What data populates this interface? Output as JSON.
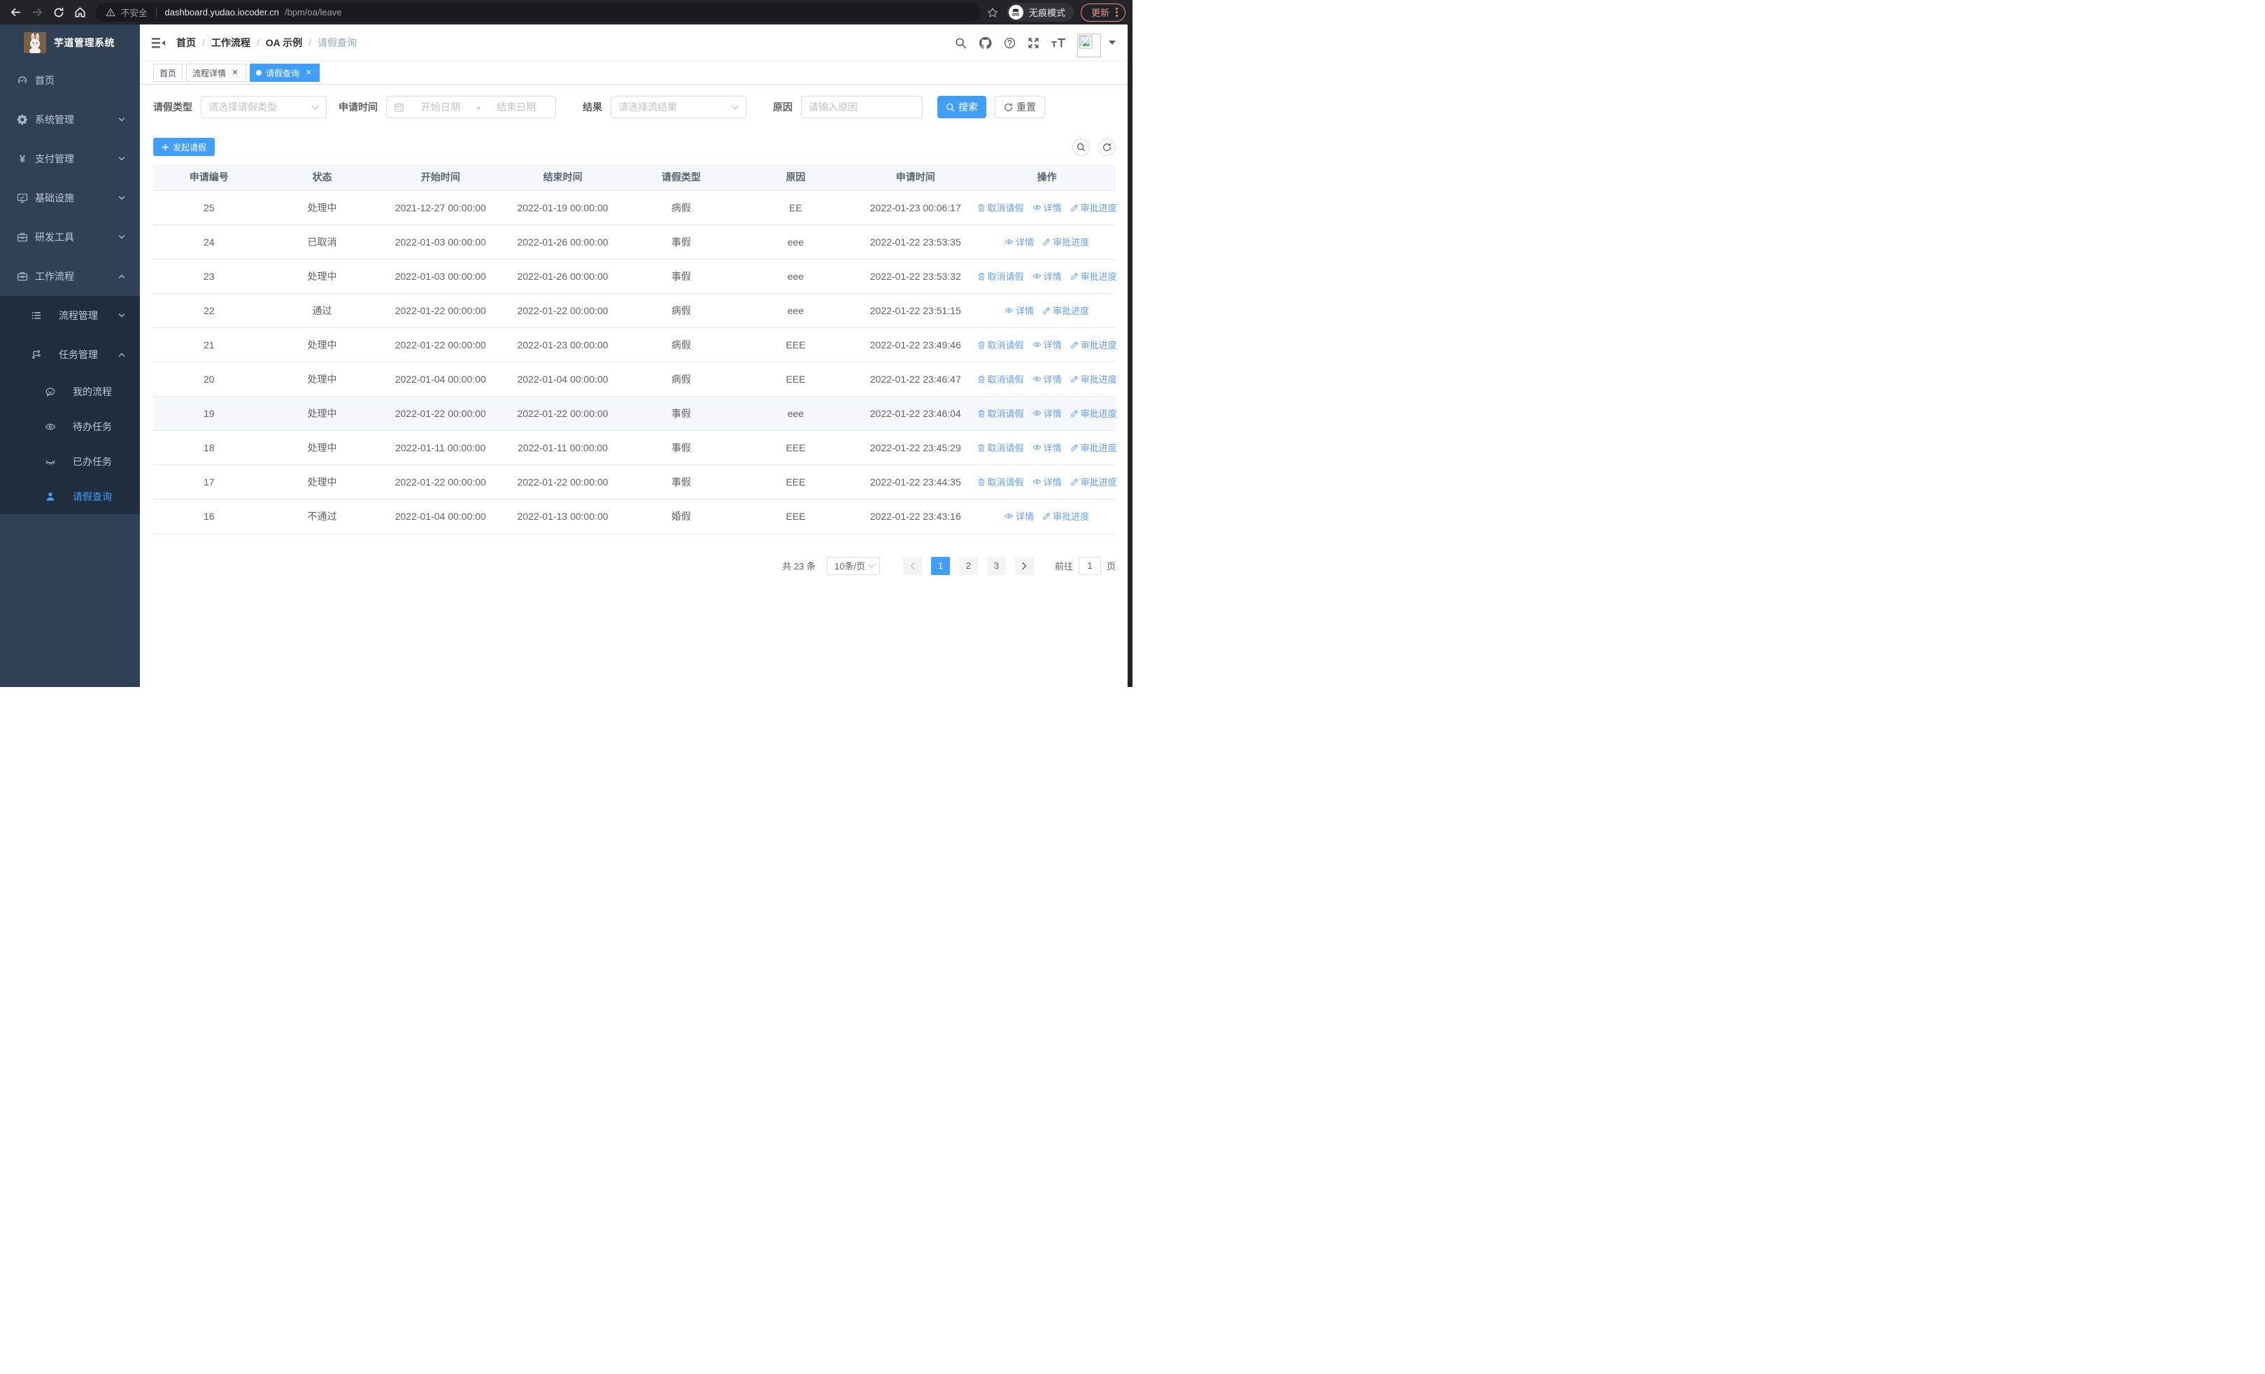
{
  "browser": {
    "security_warning": "不安全",
    "url_host": "dashboard.yudao.iocoder.cn",
    "url_path": "/bpm/oa/leave",
    "incognito_label": "无痕模式",
    "update_label": "更新"
  },
  "sidebar": {
    "app_title": "芋道管理系统",
    "menu": [
      {
        "label": "首页",
        "icon": "dashboard-icon",
        "level": 1
      },
      {
        "label": "系统管理",
        "icon": "gear-icon",
        "level": 1,
        "chevron": "down"
      },
      {
        "label": "支付管理",
        "icon": "yen-icon",
        "level": 1,
        "chevron": "down"
      },
      {
        "label": "基础设施",
        "icon": "monitor-icon",
        "level": 1,
        "chevron": "down"
      },
      {
        "label": "研发工具",
        "icon": "toolbox-icon",
        "level": 1,
        "chevron": "down"
      },
      {
        "label": "工作流程",
        "icon": "workflow-icon",
        "level": 1,
        "chevron": "up"
      },
      {
        "label": "流程管理",
        "icon": "process-list-icon",
        "level": 2,
        "chevron": "down",
        "dark": true
      },
      {
        "label": "任务管理",
        "icon": "task-node-icon",
        "level": 2,
        "chevron": "up",
        "dark": true
      },
      {
        "label": "我的流程",
        "icon": "my-process-icon",
        "level": 3,
        "dark": true
      },
      {
        "label": "待办任务",
        "icon": "eye-icon",
        "level": 3,
        "dark": true
      },
      {
        "label": "已办任务",
        "icon": "eye-closed-icon",
        "level": 3,
        "dark": true
      },
      {
        "label": "请假查询",
        "icon": "user-icon",
        "level": 3,
        "dark": true,
        "active": true
      }
    ]
  },
  "navbar": {
    "breadcrumb": [
      "首页",
      "工作流程",
      "OA 示例",
      "请假查询"
    ]
  },
  "tags": [
    {
      "label": "首页",
      "closable": false,
      "active": false
    },
    {
      "label": "流程详情",
      "closable": true,
      "active": false
    },
    {
      "label": "请假查询",
      "closable": true,
      "active": true
    }
  ],
  "filters": {
    "leave_type_label": "请假类型",
    "leave_type_placeholder": "请选择请假类型",
    "apply_time_label": "申请时间",
    "date_start_placeholder": "开始日期",
    "date_separator": "-",
    "date_end_placeholder": "结束日期",
    "result_label": "结果",
    "result_placeholder": "请选择流结果",
    "reason_label": "原因",
    "reason_placeholder": "请输入原因",
    "search_button": "搜索",
    "reset_button": "重置"
  },
  "toolbar": {
    "create_button": "发起请假"
  },
  "table": {
    "headers": [
      "申请编号",
      "状态",
      "开始时间",
      "结束时间",
      "请假类型",
      "原因",
      "申请时间",
      "操作"
    ],
    "action_labels": {
      "cancel": "取消请假",
      "detail": "详情",
      "progress": "审批进度"
    },
    "rows": [
      {
        "id": "25",
        "status": "处理中",
        "start": "2021-12-27 00:00:00",
        "end": "2022-01-19 00:00:00",
        "type": "病假",
        "reason": "EE",
        "apply_time": "2022-01-23 00:06:17",
        "actions": [
          "cancel",
          "detail",
          "progress"
        ],
        "highlight": false
      },
      {
        "id": "24",
        "status": "已取消",
        "start": "2022-01-03 00:00:00",
        "end": "2022-01-26 00:00:00",
        "type": "事假",
        "reason": "eee",
        "apply_time": "2022-01-22 23:53:35",
        "actions": [
          "detail",
          "progress"
        ],
        "highlight": false
      },
      {
        "id": "23",
        "status": "处理中",
        "start": "2022-01-03 00:00:00",
        "end": "2022-01-26 00:00:00",
        "type": "事假",
        "reason": "eee",
        "apply_time": "2022-01-22 23:53:32",
        "actions": [
          "cancel",
          "detail",
          "progress"
        ],
        "highlight": false
      },
      {
        "id": "22",
        "status": "通过",
        "start": "2022-01-22 00:00:00",
        "end": "2022-01-22 00:00:00",
        "type": "病假",
        "reason": "eee",
        "apply_time": "2022-01-22 23:51:15",
        "actions": [
          "detail",
          "progress"
        ],
        "highlight": false
      },
      {
        "id": "21",
        "status": "处理中",
        "start": "2022-01-22 00:00:00",
        "end": "2022-01-23 00:00:00",
        "type": "病假",
        "reason": "EEE",
        "apply_time": "2022-01-22 23:49:46",
        "actions": [
          "cancel",
          "detail",
          "progress"
        ],
        "highlight": false
      },
      {
        "id": "20",
        "status": "处理中",
        "start": "2022-01-04 00:00:00",
        "end": "2022-01-04 00:00:00",
        "type": "病假",
        "reason": "EEE",
        "apply_time": "2022-01-22 23:46:47",
        "actions": [
          "cancel",
          "detail",
          "progress"
        ],
        "highlight": false
      },
      {
        "id": "19",
        "status": "处理中",
        "start": "2022-01-22 00:00:00",
        "end": "2022-01-22 00:00:00",
        "type": "事假",
        "reason": "eee",
        "apply_time": "2022-01-22 23:46:04",
        "actions": [
          "cancel",
          "detail",
          "progress"
        ],
        "highlight": true
      },
      {
        "id": "18",
        "status": "处理中",
        "start": "2022-01-11 00:00:00",
        "end": "2022-01-11 00:00:00",
        "type": "事假",
        "reason": "EEE",
        "apply_time": "2022-01-22 23:45:29",
        "actions": [
          "cancel",
          "detail",
          "progress"
        ],
        "highlight": false
      },
      {
        "id": "17",
        "status": "处理中",
        "start": "2022-01-22 00:00:00",
        "end": "2022-01-22 00:00:00",
        "type": "事假",
        "reason": "EEE",
        "apply_time": "2022-01-22 23:44:35",
        "actions": [
          "cancel",
          "detail",
          "progress"
        ],
        "highlight": false
      },
      {
        "id": "16",
        "status": "不通过",
        "start": "2022-01-04 00:00:00",
        "end": "2022-01-13 00:00:00",
        "type": "婚假",
        "reason": "EEE",
        "apply_time": "2022-01-22 23:43:16",
        "actions": [
          "detail",
          "progress"
        ],
        "highlight": false
      }
    ]
  },
  "pagination": {
    "total_text": "共 23 条",
    "page_size": "10条/页",
    "pages": [
      "1",
      "2",
      "3"
    ],
    "active_page": "1",
    "goto_label": "前往",
    "goto_value": "1",
    "page_unit": "页"
  },
  "colors": {
    "primary": "#409eff",
    "sidebar_bg": "#304156",
    "submenu_bg": "#1f2d3d",
    "action_link": "#64a0f8",
    "update_chip": "#ee9086",
    "header_bg": "#f5f7fa"
  }
}
